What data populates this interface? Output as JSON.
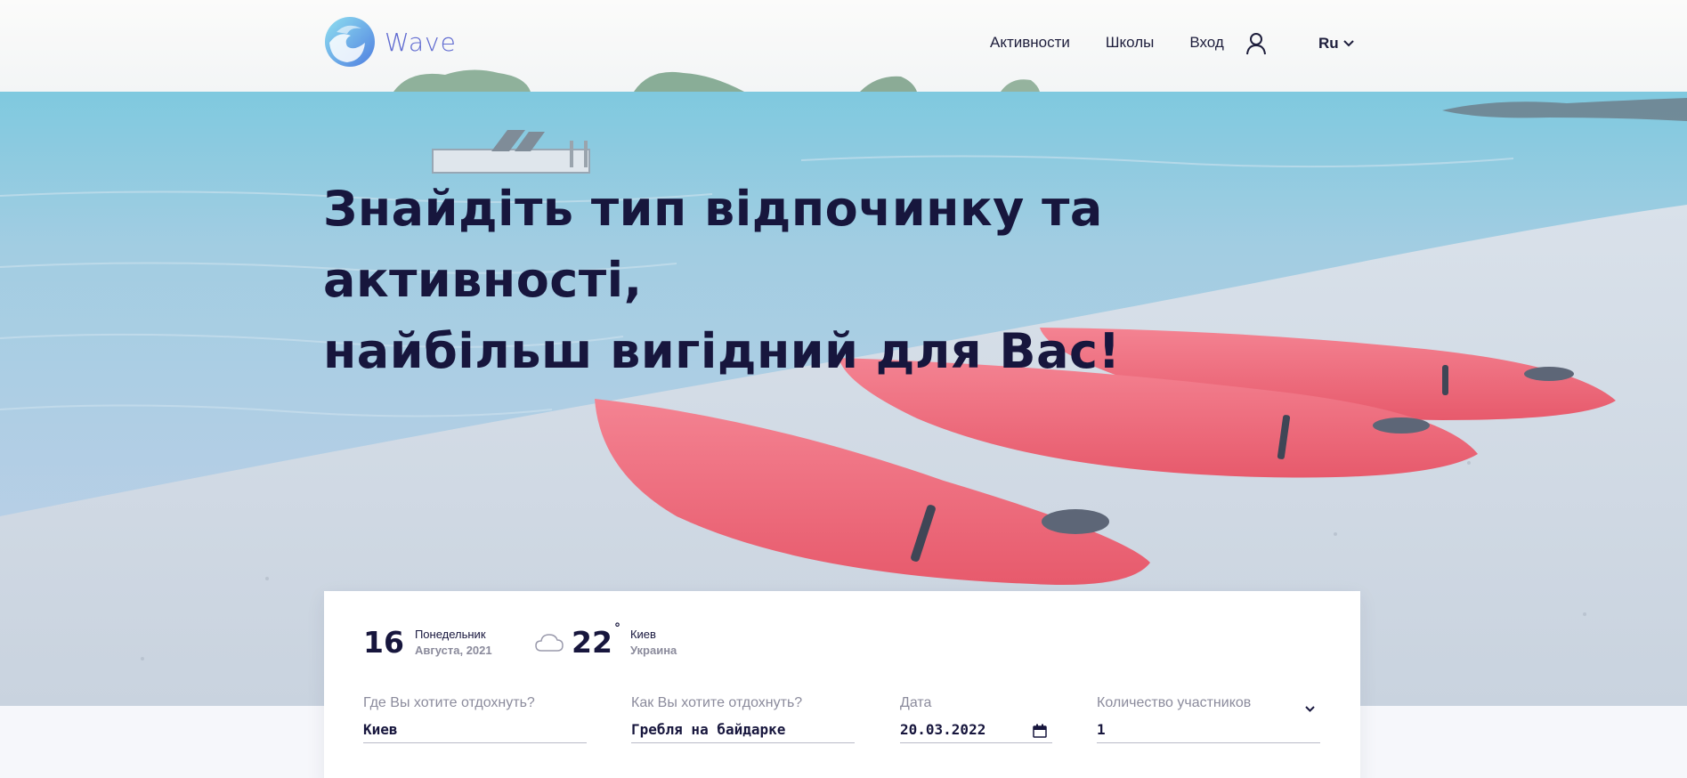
{
  "header": {
    "logo_text": "Wave",
    "nav": {
      "activities": "Активности",
      "schools": "Школы",
      "login": "Вход"
    },
    "language": "Ru"
  },
  "hero": {
    "headline_line1": "Знайдіть тип відпочинку та активності,",
    "headline_line2": "найбільш вигідний для Вас!"
  },
  "widget": {
    "date": {
      "day": "16",
      "weekday": "Понедельник",
      "month_year": "Августа, 2021"
    },
    "weather": {
      "temperature": "22",
      "degree_symbol": "°",
      "city": "Киев",
      "country": "Украина"
    }
  },
  "search": {
    "where": {
      "label": "Где Вы хотите отдохнуть?",
      "value": "Киев"
    },
    "how": {
      "label": "Как Вы хотите отдохнуть?",
      "value": "Гребля на байдарке"
    },
    "date": {
      "label": "Дата",
      "value": "20.03.2022"
    },
    "participants": {
      "label": "Количество участников",
      "value": "1"
    }
  },
  "icons": {
    "logo": "wave-logo-icon",
    "user": "user-icon",
    "language_dropdown": "chevron-down-icon",
    "weather": "cloud-icon",
    "calendar": "calendar-icon",
    "participants_dropdown": "chevron-down-icon"
  },
  "colors": {
    "accent": "#5f6ad0",
    "text_dark": "#17163d",
    "text_muted": "#8b8b9c",
    "kayak": "#ec6072",
    "sea": "#8fc0dc",
    "sand": "#d2dbe6"
  }
}
